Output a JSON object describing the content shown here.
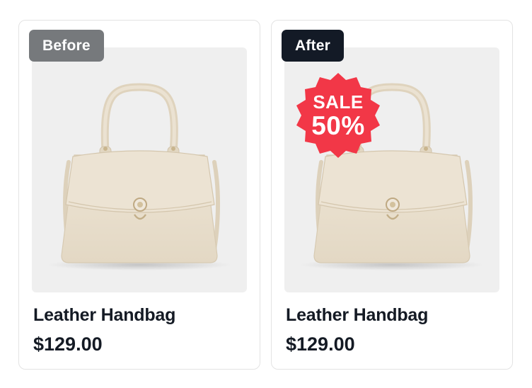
{
  "cards": [
    {
      "label": "Before",
      "title": "Leather Handbag",
      "price": "$129.00"
    },
    {
      "label": "After",
      "title": "Leather Handbag",
      "price": "$129.00",
      "badge": {
        "word": "SALE",
        "percent": "50%",
        "color": "#f23747"
      }
    }
  ],
  "colors": {
    "before_tag": "#76797c",
    "after_tag": "#131a26",
    "bag": "#e9dfcd",
    "text": "#141a24"
  }
}
